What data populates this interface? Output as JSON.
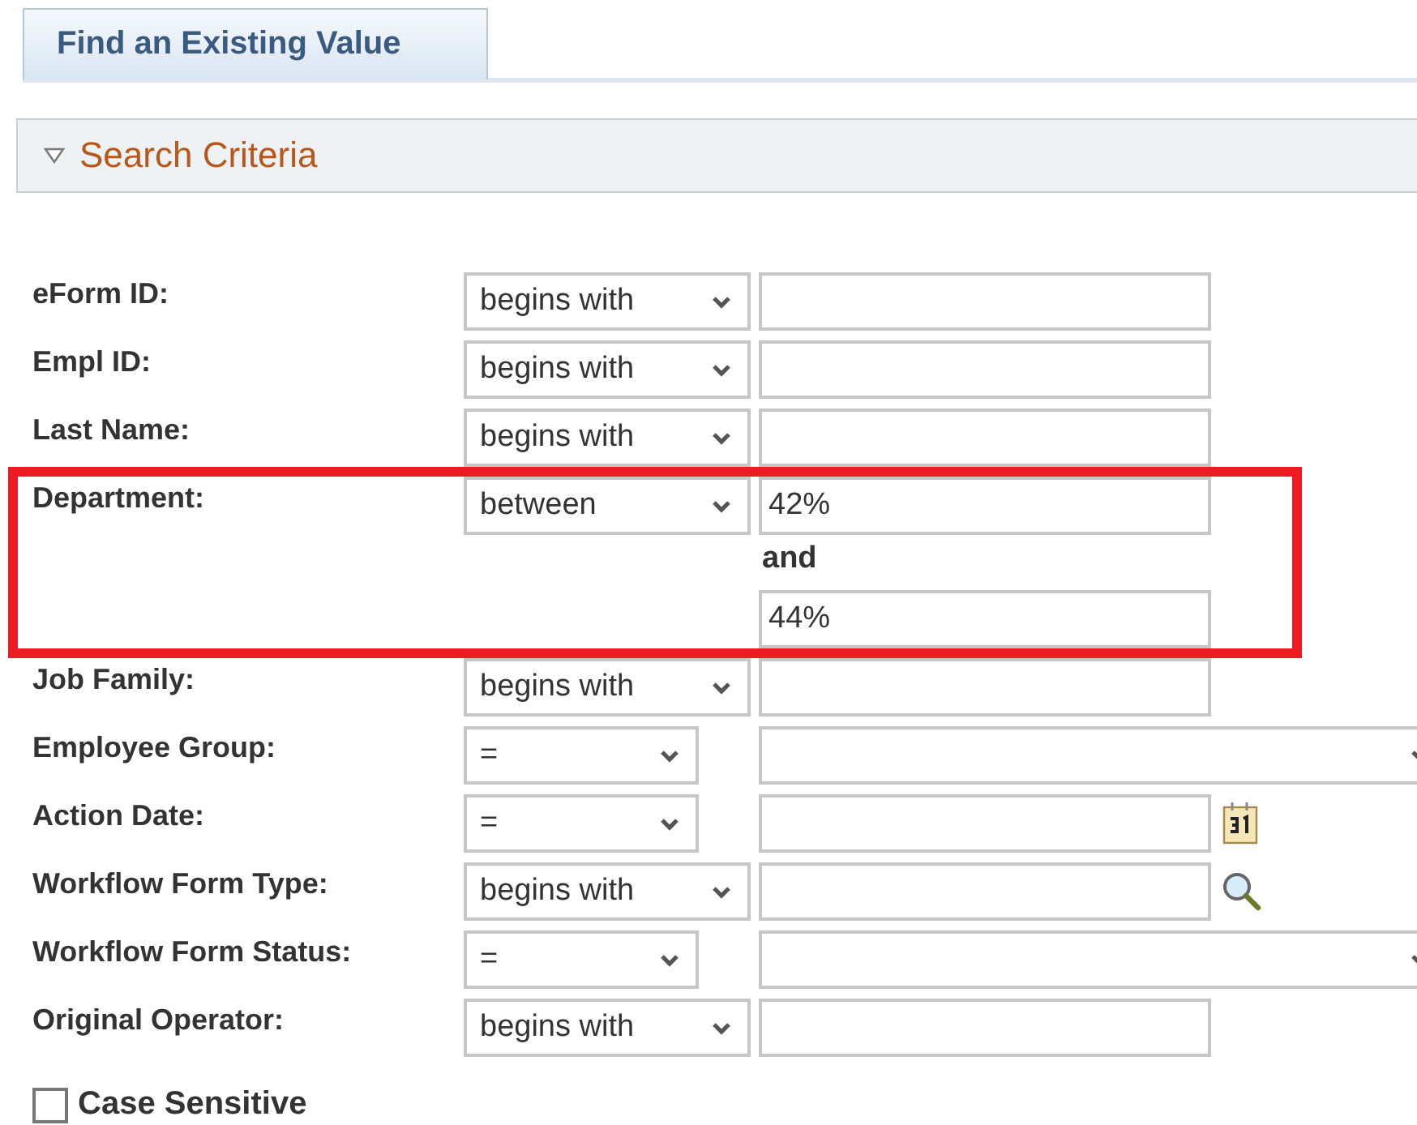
{
  "tabs": [
    {
      "label": "Find an Existing Value",
      "selected": true
    }
  ],
  "section": {
    "title": "Search Criteria",
    "expanded": true
  },
  "fields": [
    {
      "label": "eForm ID:",
      "operator": {
        "value": "begins with",
        "compact": false
      },
      "kind": "text"
    },
    {
      "label": "Empl ID:",
      "operator": {
        "value": "begins with",
        "compact": false
      },
      "kind": "text"
    },
    {
      "label": "Last Name:",
      "operator": {
        "value": "begins with",
        "compact": false
      },
      "kind": "text"
    },
    {
      "label": "Department:",
      "operator": {
        "value": "between",
        "compact": false
      },
      "kind": "between",
      "value": "42%",
      "joiner": "and",
      "value_to": "44%"
    },
    {
      "label": "Job Family:",
      "operator": {
        "value": "begins with",
        "compact": false
      },
      "kind": "text"
    },
    {
      "label": "Employee Group:",
      "operator": {
        "value": "=",
        "compact": true
      },
      "kind": "dropdown"
    },
    {
      "label": "Action Date:",
      "operator": {
        "value": "=",
        "compact": true
      },
      "kind": "date"
    },
    {
      "label": "Workflow Form Type:",
      "operator": {
        "value": "begins with",
        "compact": false
      },
      "kind": "lookup"
    },
    {
      "label": "Workflow Form Status:",
      "operator": {
        "value": "=",
        "compact": true
      },
      "kind": "dropdown"
    },
    {
      "label": "Original Operator:",
      "operator": {
        "value": "begins with",
        "compact": false
      },
      "kind": "text"
    }
  ],
  "case_sensitive": {
    "label": "Case Sensitive",
    "checked": false
  }
}
